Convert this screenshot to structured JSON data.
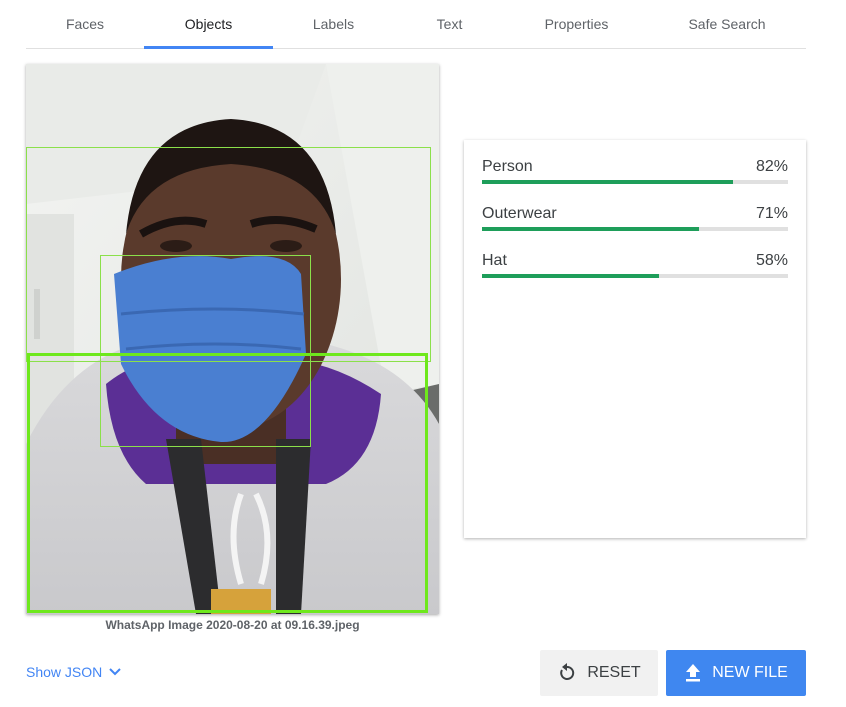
{
  "tabs": [
    {
      "label": "Faces"
    },
    {
      "label": "Objects"
    },
    {
      "label": "Labels"
    },
    {
      "label": "Text"
    },
    {
      "label": "Properties"
    },
    {
      "label": "Safe Search"
    }
  ],
  "active_tab": "Objects",
  "image": {
    "caption": "WhatsApp Image 2020-08-20 at 09.16.39.jpeg",
    "detected_box_color": "#8be04a"
  },
  "results": [
    {
      "name": "Person",
      "percent_label": "82%",
      "score": 0.82
    },
    {
      "name": "Outerwear",
      "percent_label": "71%",
      "score": 0.71
    },
    {
      "name": "Hat",
      "percent_label": "58%",
      "score": 0.58
    }
  ],
  "bar_color": "#1e9e5a",
  "controls": {
    "show_json_label": "Show JSON",
    "reset_label": "RESET",
    "new_file_label": "NEW FILE"
  },
  "accent_color": "#4285f4"
}
